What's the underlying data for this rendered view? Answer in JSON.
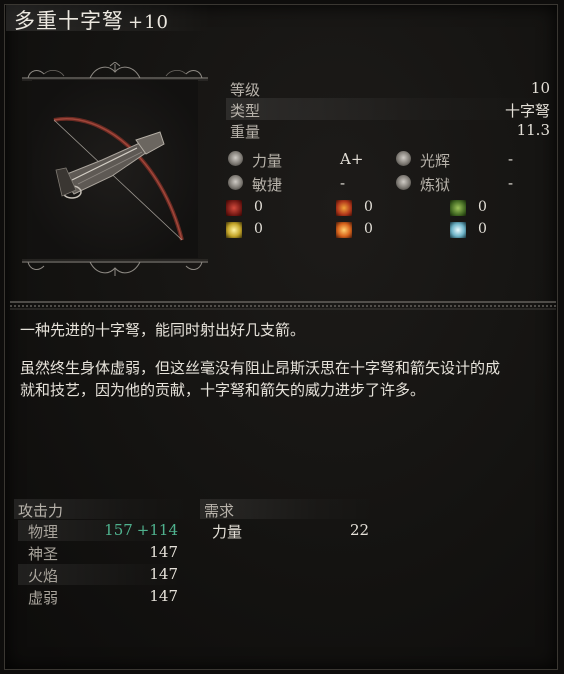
{
  "item": {
    "name": "多重十字弩",
    "upgrade": "+10"
  },
  "stats": [
    {
      "label": "等级",
      "value": "10"
    },
    {
      "label": "类型",
      "value": "十字弩"
    },
    {
      "label": "重量",
      "value": "11.3"
    }
  ],
  "scaling": [
    {
      "icon": "strength-icon",
      "label": "力量",
      "grade": "A+"
    },
    {
      "icon": "radiance-icon",
      "label": "光辉",
      "grade": "-"
    },
    {
      "icon": "dexterity-icon",
      "label": "敏捷",
      "grade": "-"
    },
    {
      "icon": "inferno-icon",
      "label": "炼狱",
      "grade": "-"
    }
  ],
  "buildup": [
    {
      "icon": "bleed-icon",
      "value": "0",
      "color": "#b8302a"
    },
    {
      "icon": "fire-icon",
      "value": "0",
      "color": "#e0541a"
    },
    {
      "icon": "poison-icon",
      "value": "0",
      "color": "#6f9a34"
    },
    {
      "icon": "lightning-icon",
      "value": "0",
      "color": "#e6d24a"
    },
    {
      "icon": "flame-burst-icon",
      "value": "0",
      "color": "#e8731f"
    },
    {
      "icon": "frost-icon",
      "value": "0",
      "color": "#a8d8e6"
    }
  ],
  "description": {
    "line1": "一种先进的十字弩，能同时射出好几支箭。",
    "line2": "虽然终生身体虚弱，但这丝毫没有阻止昂斯沃思在十字弩和箭矢设计的成",
    "line3": "就和技艺，因为他的贡献，十字弩和箭矢的威力进步了许多。"
  },
  "attack": {
    "header": "攻击力",
    "rows": [
      {
        "label": "物理",
        "base": "157",
        "bonus": "+114"
      },
      {
        "label": "神圣",
        "value": "147"
      },
      {
        "label": "火焰",
        "value": "147"
      },
      {
        "label": "虚弱",
        "value": "147"
      }
    ]
  },
  "requirements": {
    "header": "需求",
    "rows": [
      {
        "label": "力量",
        "value": "22"
      }
    ]
  },
  "colors": {
    "bonus_green": "#4fb28e",
    "background": "#141311"
  }
}
